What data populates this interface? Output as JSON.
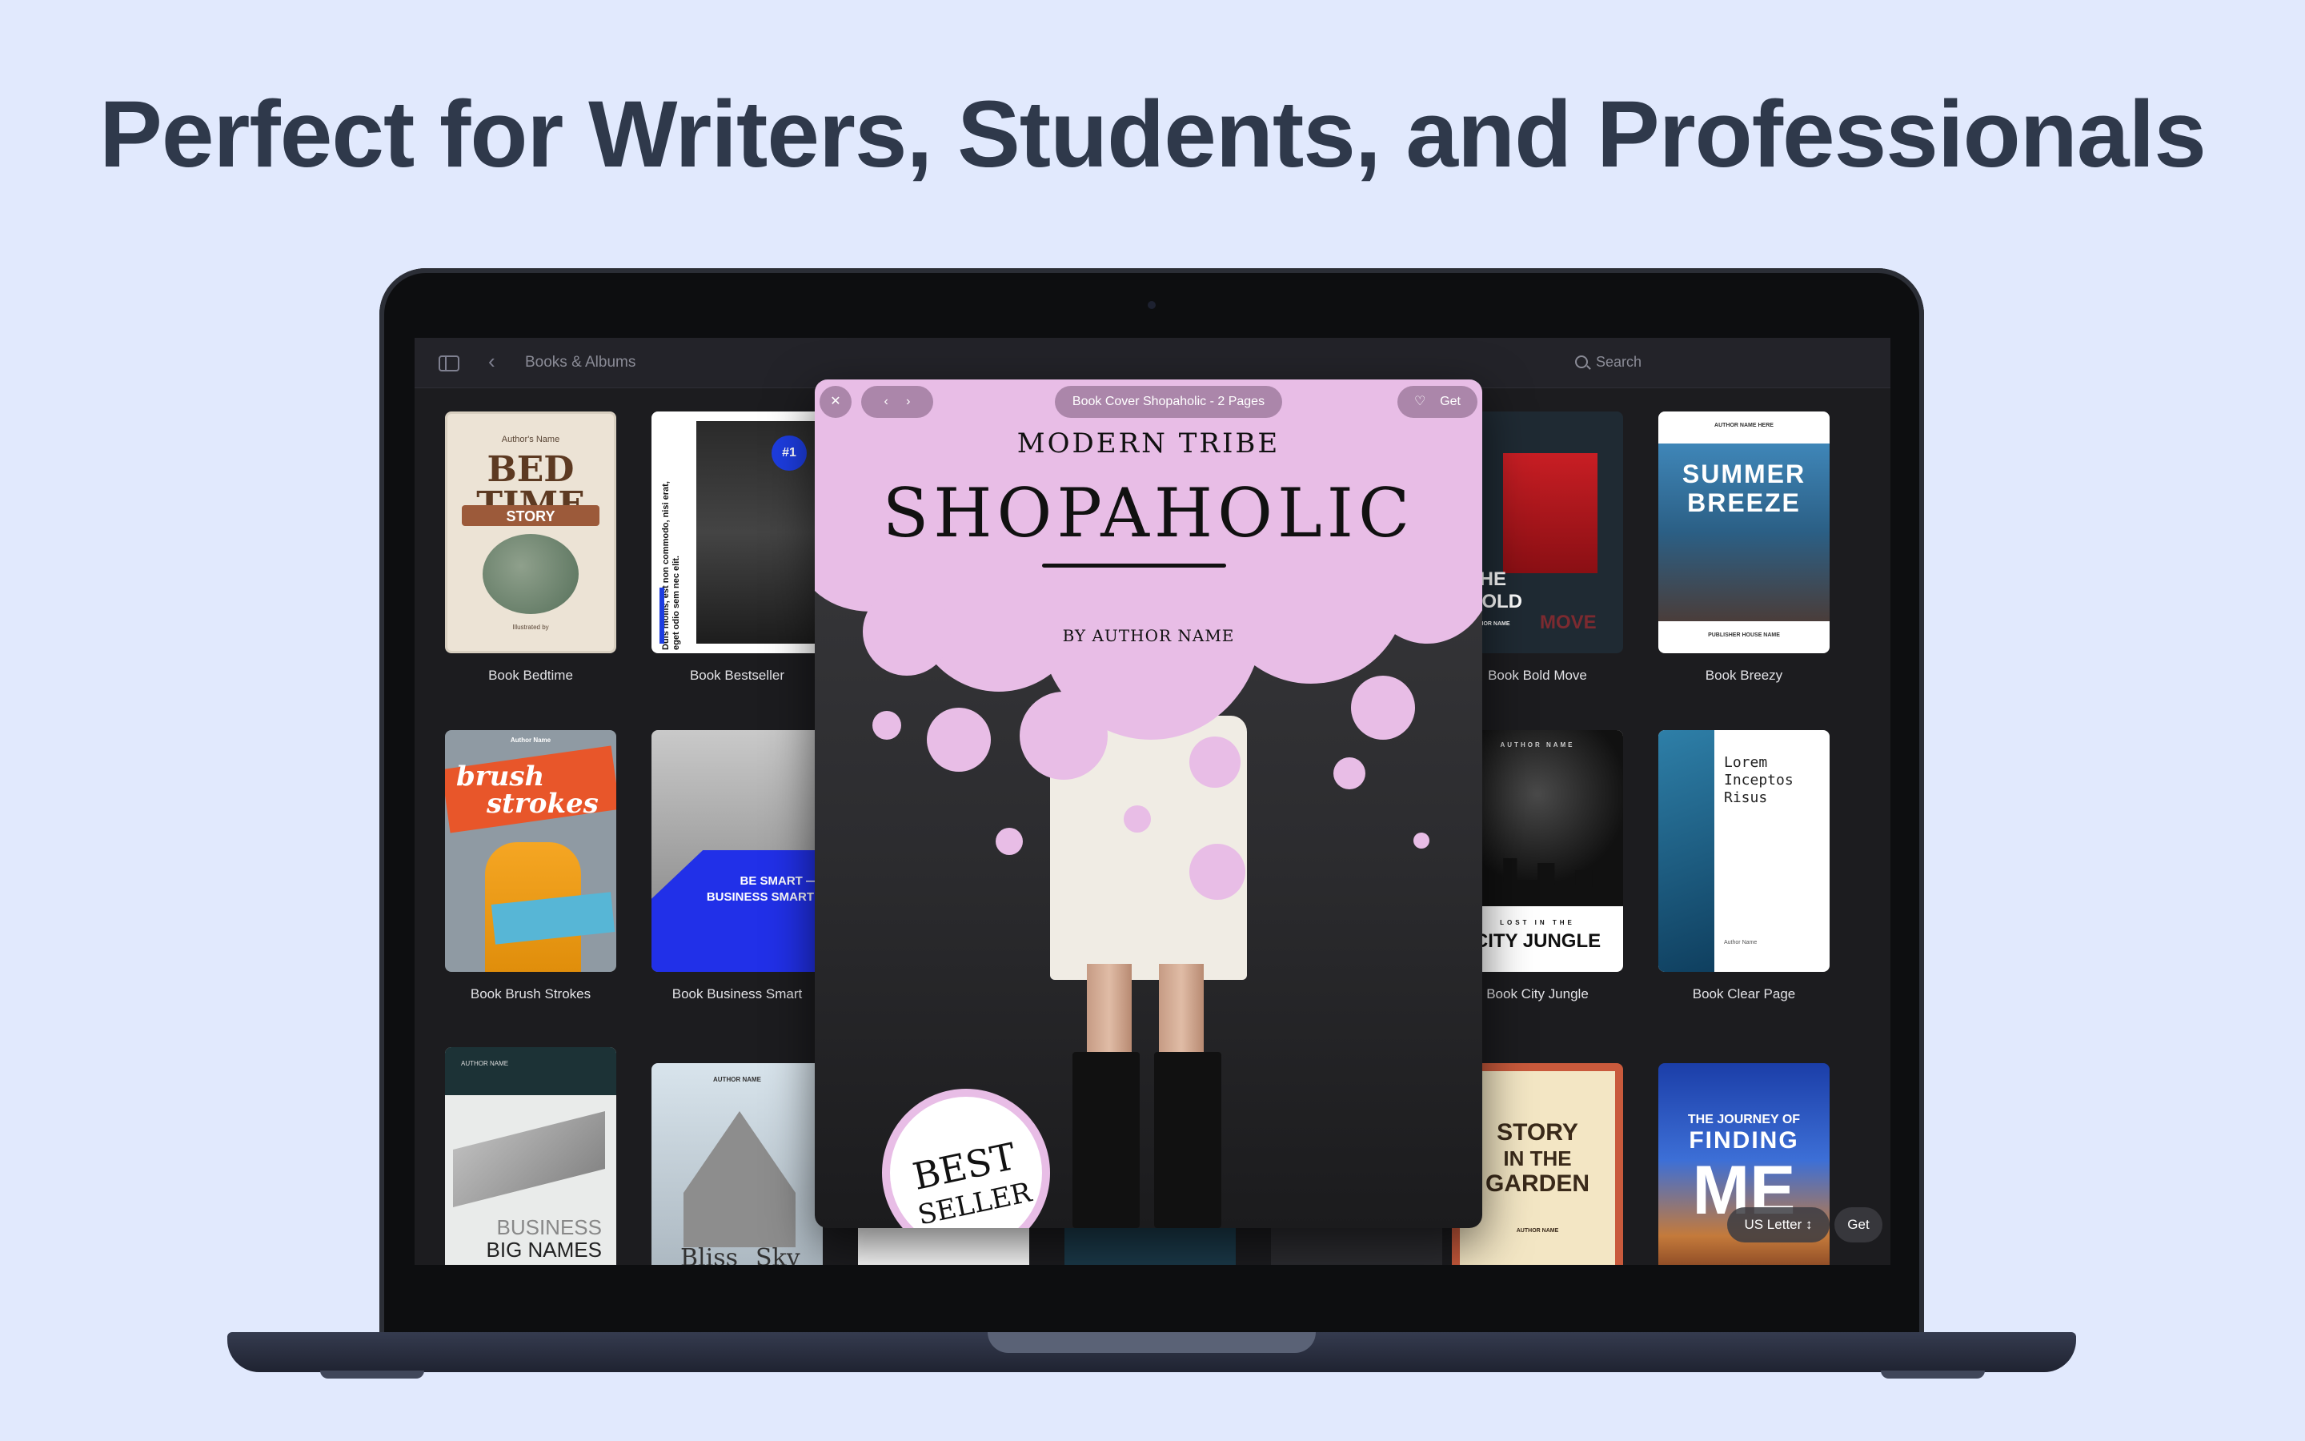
{
  "headline": "Perfect for Writers, Students, and Professionals",
  "toolbar": {
    "title": "Books & Albums",
    "search_label": "Search"
  },
  "grid": [
    {
      "label": "Book Bedtime",
      "cover": {
        "t1": "Author's Name",
        "t2": "BED",
        "t3": "TIME",
        "t4": "STORY",
        "t5": "Illustrated by"
      }
    },
    {
      "label": "Book Bestseller",
      "cover": {
        "t1": "#1",
        "t2": "Duis mollis, est non commodo, nisi erat, eget odio sem nec elit."
      }
    },
    {
      "label": "Book Bold Move",
      "cover": {
        "t1": "THE",
        "t2": "BOLD",
        "t3": "MOVE",
        "t4": "AUTHOR NAME"
      }
    },
    {
      "label": "Book Breezy",
      "cover": {
        "t1": "AUTHOR NAME HERE",
        "t2": "SUMMER",
        "t3": "BREEZE",
        "t4": "PUBLISHER HOUSE NAME"
      }
    },
    {
      "label": "Book Brush Strokes",
      "cover": {
        "t1": "Author Name",
        "t2": "brush",
        "t3": "strokes"
      }
    },
    {
      "label": "Book Business Smart",
      "cover": {
        "t1": "BE SMART —",
        "t2": "BUSINESS SMART!"
      }
    },
    {
      "label": "Book City Jungle",
      "cover": {
        "t1": "AUTHOR NAME",
        "t2": "LOST IN THE",
        "t3": "CITY JUNGLE"
      }
    },
    {
      "label": "Book Clear Page",
      "cover": {
        "t1": "Lorem",
        "t2": "Inceptos",
        "t3": "Risus",
        "t4": "Author Name"
      }
    },
    {
      "label": "",
      "cover": {
        "t1": "AUTHOR NAME",
        "t2": "BUSINESS",
        "t3": "BIG NAMES"
      }
    },
    {
      "label": "",
      "cover": {
        "t1": "AUTHOR NAME",
        "t2": "Bliss",
        "t3": "Sky"
      }
    },
    {
      "label": "",
      "cover": {
        "t1": "STORY",
        "t2": "IN THE",
        "t3": "GARDEN",
        "t4": "AUTHOR NAME"
      }
    },
    {
      "label": "",
      "cover": {
        "t1": "THE JOURNEY OF",
        "t2": "FINDING",
        "t3": "ME"
      }
    }
  ],
  "modal": {
    "pill": "Book Cover Shopaholic - 2 Pages",
    "get_label": "Get",
    "series": "MODERN TRIBE",
    "title": "SHOPAHOLIC",
    "byline": "BY AUTHOR NAME",
    "badge_line1": "BEST",
    "badge_line2": "SELLER"
  },
  "bottom_controls": {
    "paper_size": "US Letter",
    "get_label": "Get"
  },
  "colors": {
    "background": "#e1e9fd",
    "pink": "#e8bde6",
    "screen": "#1c1c1f"
  }
}
